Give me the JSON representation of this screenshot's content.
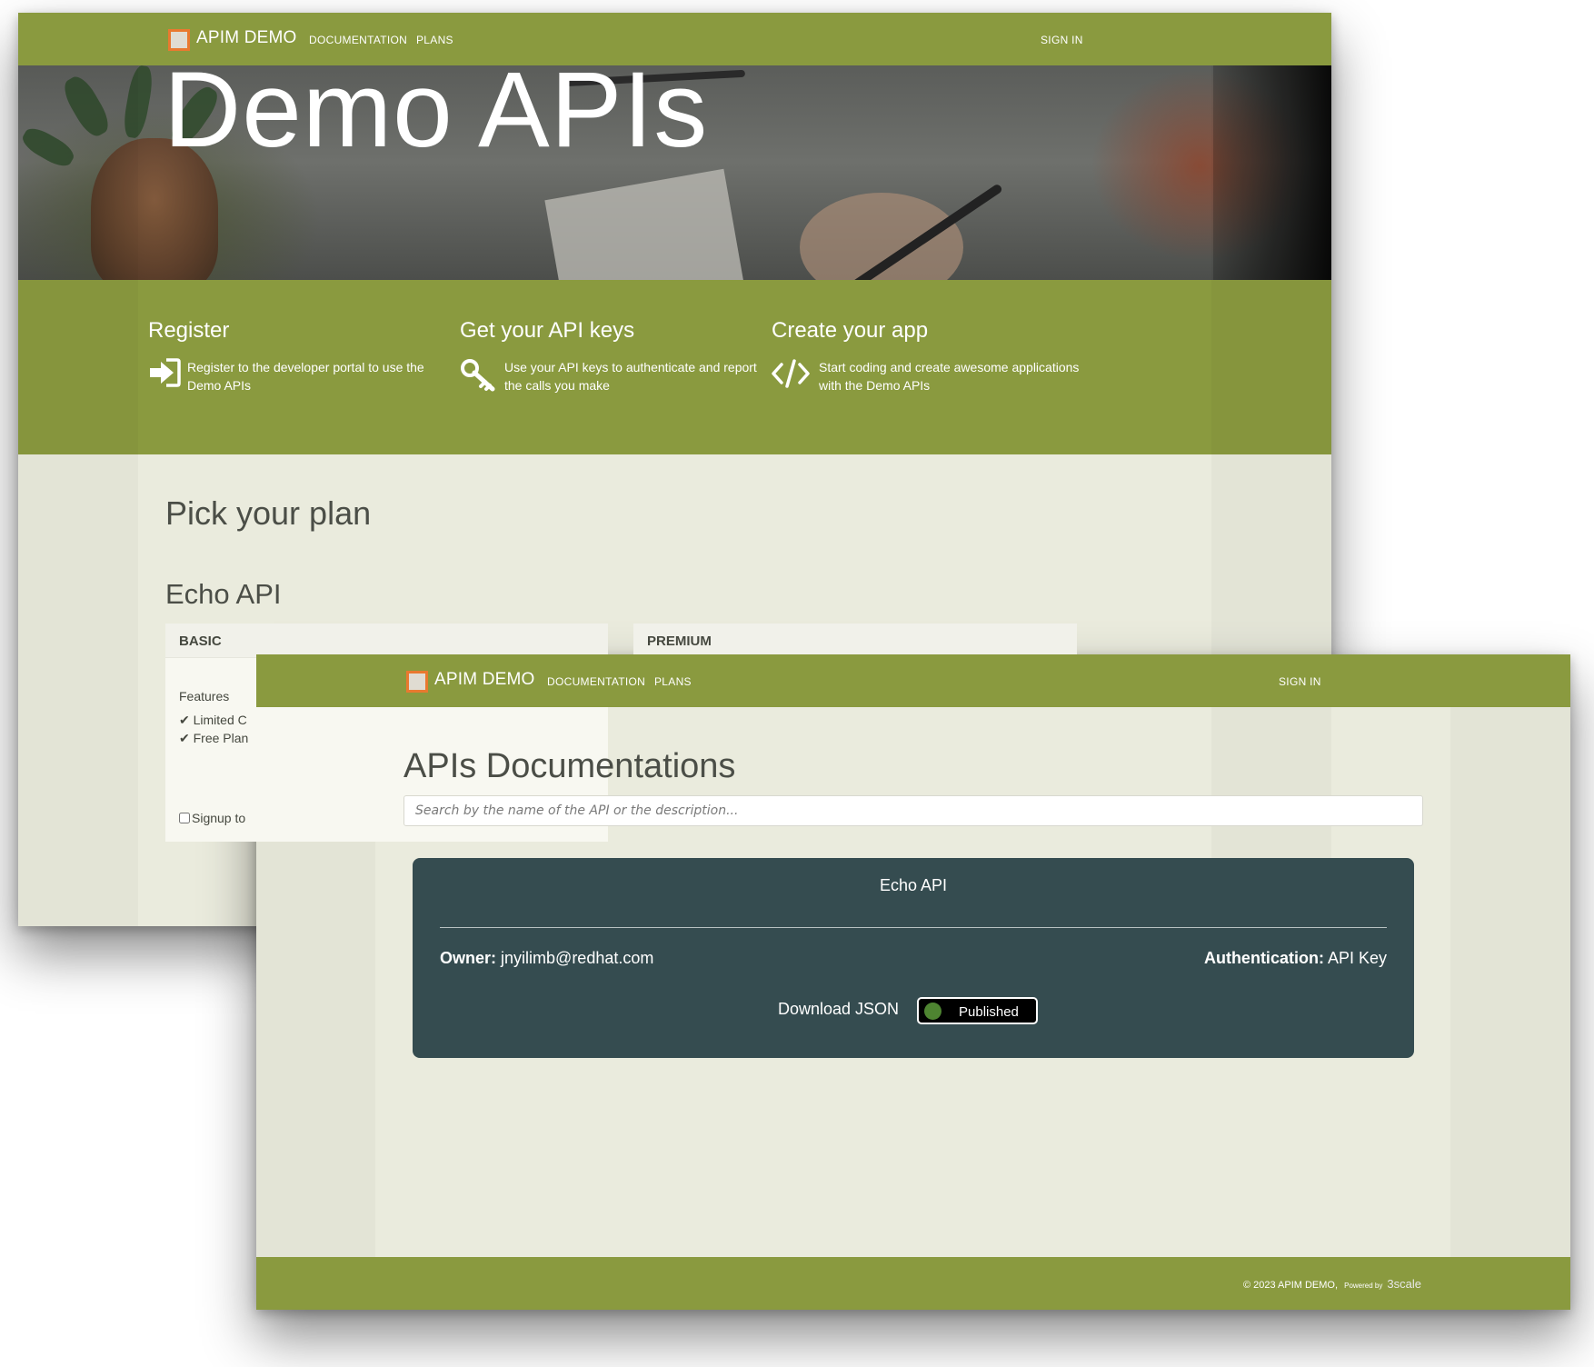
{
  "nav": {
    "brand": "APIM DEMO",
    "documentation": "DOCUMENTATION",
    "plans": "PLANS",
    "sign_in": "SIGN IN"
  },
  "hero": {
    "title": "Demo APIs"
  },
  "steps": [
    {
      "title": "Register",
      "icon": "sign-in-arrow-icon",
      "text": "Register to the developer portal to use the Demo APIs"
    },
    {
      "title": "Get your API keys",
      "icon": "key-icon",
      "text": "Use your API keys to authenticate and report the calls you make"
    },
    {
      "title": "Create your app",
      "icon": "code-icon",
      "text": "Start coding and create awesome applications with the Demo APIs"
    }
  ],
  "plans_page": {
    "heading": "Pick your plan",
    "api_title": "Echo API",
    "basic": {
      "name": "BASIC",
      "features_label": "Features",
      "features": [
        "Limited C",
        "Free Plan"
      ],
      "signup": "Signup to"
    },
    "premium": {
      "name": "PREMIUM"
    }
  },
  "docs_page": {
    "heading": "APIs Documentations",
    "search_placeholder": "Search by the name of the API or the description...",
    "api": {
      "name": "Echo API",
      "owner_label": "Owner:",
      "owner": "jnyilimb@redhat.com",
      "auth_label": "Authentication:",
      "auth": "API Key",
      "download": "Download JSON",
      "status": "Published"
    }
  },
  "footer": {
    "copyright": "© 2023 APIM DEMO,",
    "powered_by": "Powered by",
    "powered_brand": "3scale"
  },
  "colors": {
    "brand_green": "#8a9a3f",
    "page_bg": "#eaebdd",
    "card_dark": "#354c50",
    "logo_orange": "#e9792f",
    "toggle_knob": "#4e8431"
  }
}
